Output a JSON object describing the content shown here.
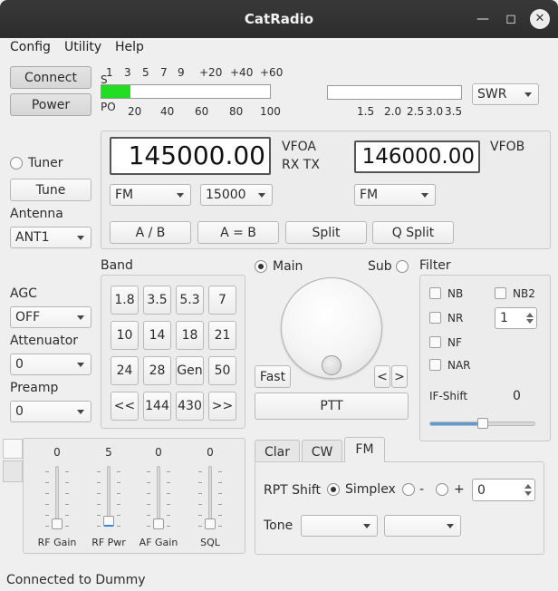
{
  "window": {
    "title": "CatRadio"
  },
  "menu": [
    "Config",
    "Utility",
    "Help"
  ],
  "connection": {
    "connect_label": "Connect",
    "power_label": "Power"
  },
  "meter": {
    "s_scale": [
      "S",
      "1",
      "3",
      "5",
      "7",
      "9",
      "+20",
      "+40",
      "+60"
    ],
    "po_scale": [
      "PO",
      "20",
      "40",
      "60",
      "80",
      "100"
    ],
    "level_fraction": 0.17,
    "swr_scale": [
      "1.5",
      "2.0",
      "2.5",
      "3.0",
      "3.5"
    ],
    "swr_level_fraction": 0.0,
    "meter_select": "SWR"
  },
  "tuner": {
    "label": "Tuner",
    "tune_label": "Tune",
    "antenna_label": "Antenna",
    "antenna_value": "ANT1"
  },
  "vfo": {
    "vfoa_freq": "145000.00",
    "vfoa_label": "VFOA",
    "rxtx_label": "RX TX",
    "vfob_freq": "146000.00",
    "vfob_label": "VFOB",
    "mode_a": "FM",
    "bw_a": "15000",
    "mode_b": "FM",
    "buttons": [
      "A / B",
      "A = B",
      "Split",
      "Q Split"
    ]
  },
  "agc": {
    "label": "AGC",
    "value": "OFF"
  },
  "attenuator": {
    "label": "Attenuator",
    "value": "0"
  },
  "preamp": {
    "label": "Preamp",
    "value": "0"
  },
  "band": {
    "title": "Band",
    "buttons": [
      "1.8",
      "3.5",
      "5.3",
      "7",
      "10",
      "14",
      "18",
      "21",
      "24",
      "28",
      "Gen",
      "50",
      "<<",
      "144",
      "430",
      ">>"
    ]
  },
  "tuning": {
    "main_label": "Main",
    "sub_label": "Sub",
    "fast_label": "Fast",
    "left_label": "<",
    "right_label": ">",
    "ptt_label": "PTT"
  },
  "filter": {
    "title": "Filter",
    "nb": "NB",
    "nb2": "NB2",
    "nr": "NR",
    "nr_value": "1",
    "nf": "NF",
    "nar": "NAR",
    "ifshift_label": "IF-Shift",
    "ifshift_value": "0",
    "ifshift_fraction": 0.5
  },
  "gains": [
    {
      "label": "RF Gain",
      "value": "0",
      "fraction": 0.0
    },
    {
      "label": "RF Pwr",
      "value": "5",
      "fraction": 0.05
    },
    {
      "label": "AF Gain",
      "value": "0",
      "fraction": 0.0
    },
    {
      "label": "SQL",
      "value": "0",
      "fraction": 0.0
    }
  ],
  "tabs": [
    "Clar",
    "CW",
    "FM"
  ],
  "fm": {
    "rpt_shift_label": "RPT Shift",
    "simplex_label": "Simplex",
    "minus_label": "-",
    "plus_label": "+",
    "offset_value": "0",
    "tone_label": "Tone"
  },
  "status": {
    "text": "Connected to Dummy"
  }
}
